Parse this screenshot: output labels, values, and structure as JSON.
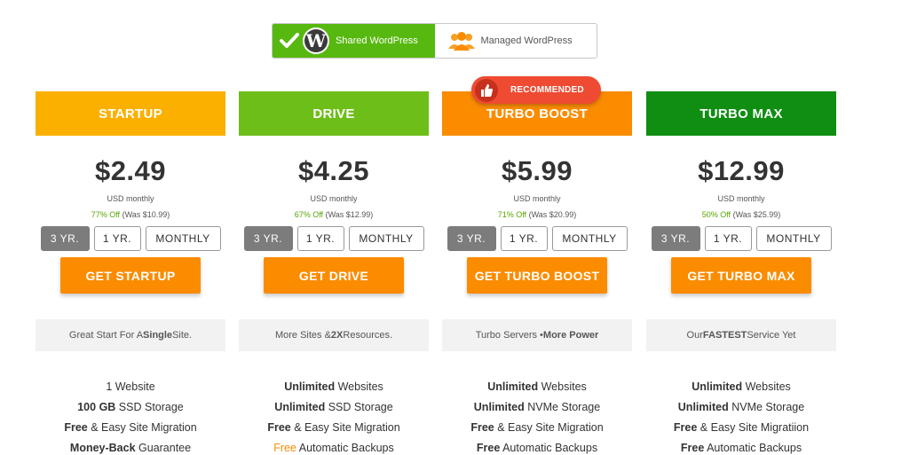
{
  "toggle": {
    "shared_label": "Shared WordPress",
    "managed_label": "Managed WordPress"
  },
  "badge": {
    "label": "RECOMMENDED"
  },
  "plans": [
    {
      "name": "STARTUP",
      "color": "#fbb000",
      "price": "$2.49",
      "term": "USD monthly",
      "discount_pct": "77% Off",
      "discount_was": "(Was $10.99)",
      "periods": [
        "3 YR.",
        "1 YR.",
        "MONTHLY"
      ],
      "cta": "GET STARTUP",
      "tagline_pre": "Great Start For A ",
      "tagline_bold": "Single",
      "tagline_post": " Site.",
      "features": [
        {
          "bold": "1",
          "text": " Website"
        },
        {
          "bold": "100 GB",
          "text": " SSD Storage"
        },
        {
          "bold": "Free",
          "text": " & Easy Site Migration"
        },
        {
          "bold": "Money-Back",
          "text": " Guarantee"
        }
      ]
    },
    {
      "name": "DRIVE",
      "color": "#6ebe1a",
      "price": "$4.25",
      "term": "USD monthly",
      "discount_pct": "67% Off",
      "discount_was": "(Was $12.99)",
      "periods": [
        "3 YR.",
        "1 YR.",
        "MONTHLY"
      ],
      "cta": "GET DRIVE",
      "tagline_pre": "More Sites & ",
      "tagline_bold": "2X",
      "tagline_post": " Resources.",
      "features": [
        {
          "bold": "Unlimited",
          "text": " Websites"
        },
        {
          "bold": "Unlimited",
          "text": " SSD Storage"
        },
        {
          "bold": "Free",
          "text": " & Easy Site Migration"
        },
        {
          "bold": "Free",
          "text": " Automatic Backups"
        }
      ]
    },
    {
      "name": "TURBO BOOST",
      "color": "#fb8c00",
      "price": "$5.99",
      "term": "USD monthly",
      "discount_pct": "71% Off",
      "discount_was": "(Was $20.99)",
      "periods": [
        "3 YR.",
        "1 YR.",
        "MONTHLY"
      ],
      "cta": "GET TURBO BOOST",
      "tagline_pre": "Turbo Servers • ",
      "tagline_bold": "More Power",
      "tagline_post": "",
      "features": [
        {
          "bold": "Unlimited",
          "text": " Websites"
        },
        {
          "bold": "Unlimited",
          "text": " NVMe Storage"
        },
        {
          "bold": "Free",
          "text": " & Easy Site Migration"
        },
        {
          "bold": "Free",
          "text": " Automatic Backups"
        }
      ]
    },
    {
      "name": "TURBO MAX",
      "color": "#0f8e12",
      "price": "$12.99",
      "term": "USD monthly",
      "discount_pct": "50% Off",
      "discount_was": "(Was $25.99)",
      "periods": [
        "3 YR.",
        "1 YR.",
        "MONTHLY"
      ],
      "cta": "GET TURBO MAX",
      "tagline_pre": "Our ",
      "tagline_bold": "FASTEST",
      "tagline_post": " Service Yet",
      "features": [
        {
          "bold": "Unlimited",
          "text": " Websites"
        },
        {
          "bold": "Unlimited",
          "text": " NVMe Storage"
        },
        {
          "bold": "Free",
          "text": " & Easy Site Migratiion"
        },
        {
          "bold": "Free",
          "text": " Automatic Backups"
        }
      ]
    }
  ],
  "colors": {
    "shared_active": "#57b80f",
    "cta": "#fb8c00",
    "badge": "#ee4b32",
    "drive_free_accent": "#fb8c00"
  }
}
